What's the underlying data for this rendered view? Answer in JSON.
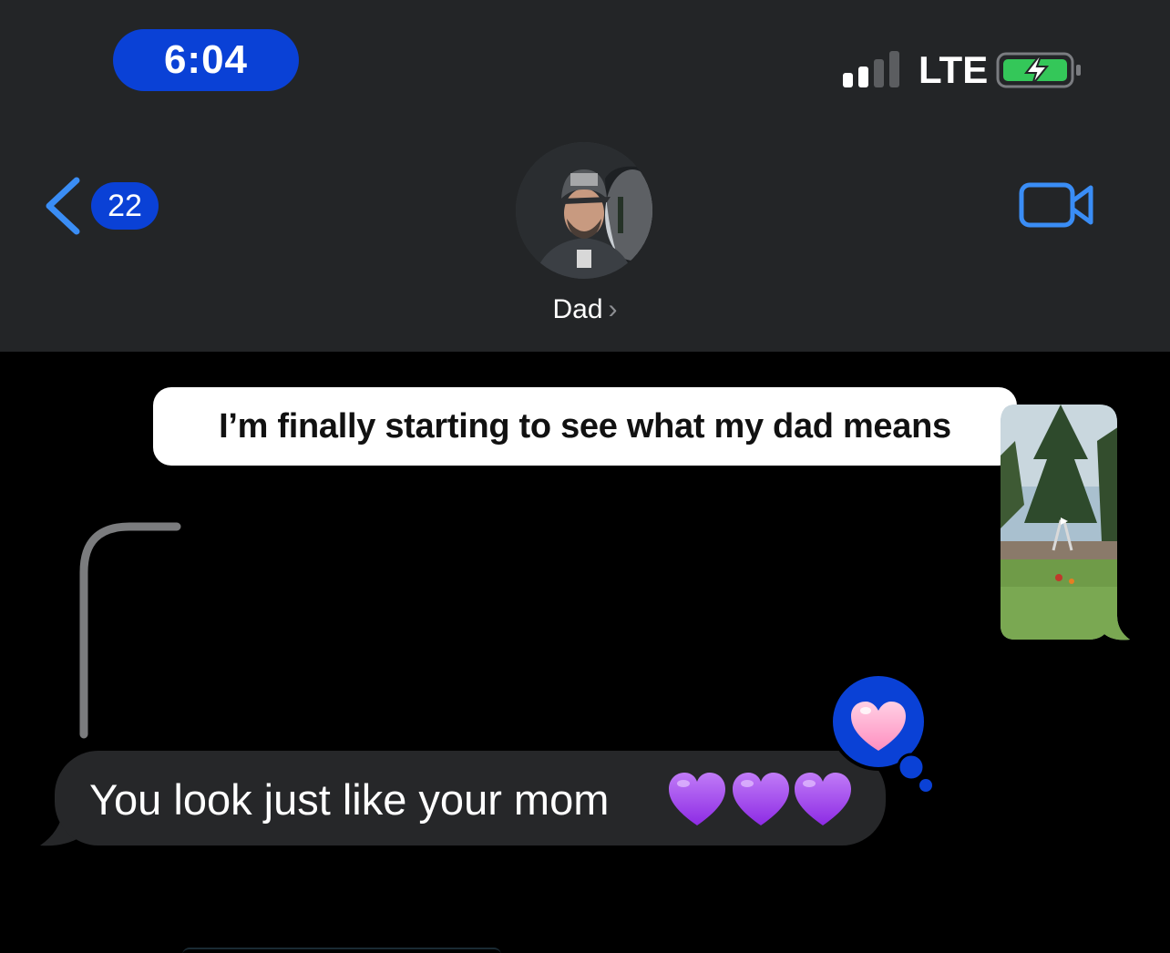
{
  "status_bar": {
    "time": "6:04",
    "network": "LTE",
    "time_pill_color": "#0a41d6",
    "signal_bars_filled": 2,
    "signal_bars_total": 4,
    "battery_charging": true,
    "battery_color": "#34c759"
  },
  "nav": {
    "back_icon": "chevron-left-icon",
    "unread_count": "22",
    "contact_name": "Dad",
    "contact_chevron": "›",
    "video_icon": "video-camera-icon",
    "accent_color": "#3a8df5"
  },
  "messages": {
    "quoted_text": "I’m finally starting to see what my dad means",
    "incoming_text": "You look just like your mom",
    "incoming_emojis": [
      "purple-heart",
      "purple-heart",
      "purple-heart"
    ],
    "tapback_reaction": "pink-heart",
    "tapback_color": "#0a41d6",
    "video_attachment_icon": "play-icon"
  }
}
